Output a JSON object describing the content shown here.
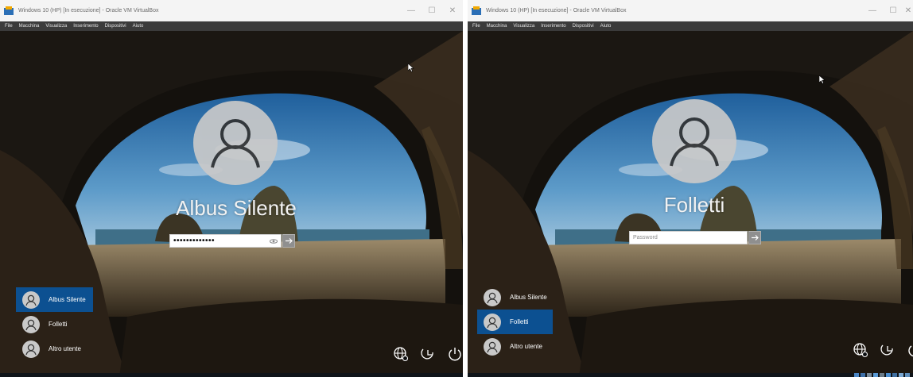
{
  "windows": [
    {
      "title": "Windows 10 (HP) [In esecuzione] - Oracle VM VirtualBox",
      "menu": [
        "File",
        "Macchina",
        "Visualizza",
        "Inserimento",
        "Dispositivi",
        "Aiuto"
      ],
      "login": {
        "username": "Albus Silente",
        "password_masked": "•••••••••••••",
        "password_placeholder": ""
      },
      "users": [
        {
          "name": "Albus Silente",
          "selected": true
        },
        {
          "name": "Folletti",
          "selected": false
        },
        {
          "name": "Altro utente",
          "selected": false
        }
      ]
    },
    {
      "title": "Windows 10 (HP) [In esecuzione] - Oracle VM VirtualBox",
      "menu": [
        "File",
        "Macchina",
        "Visualizza",
        "Inserimento",
        "Dispositivi",
        "Aiuto"
      ],
      "login": {
        "username": "Folletti",
        "password_masked": "",
        "password_placeholder": "Password"
      },
      "users": [
        {
          "name": "Albus Silente",
          "selected": false
        },
        {
          "name": "Folletti",
          "selected": true
        },
        {
          "name": "Altro utente",
          "selected": false
        }
      ]
    }
  ],
  "icons": {
    "accessibility": "ease-of-access-icon",
    "network": "network-icon",
    "power": "power-icon",
    "user": "user-icon",
    "submit": "arrow-right-icon",
    "reveal": "eye-icon"
  },
  "colors": {
    "selected_user": "#0c5091",
    "titlebar": "#f4f4f4",
    "menubar": "#3b3b3b"
  }
}
